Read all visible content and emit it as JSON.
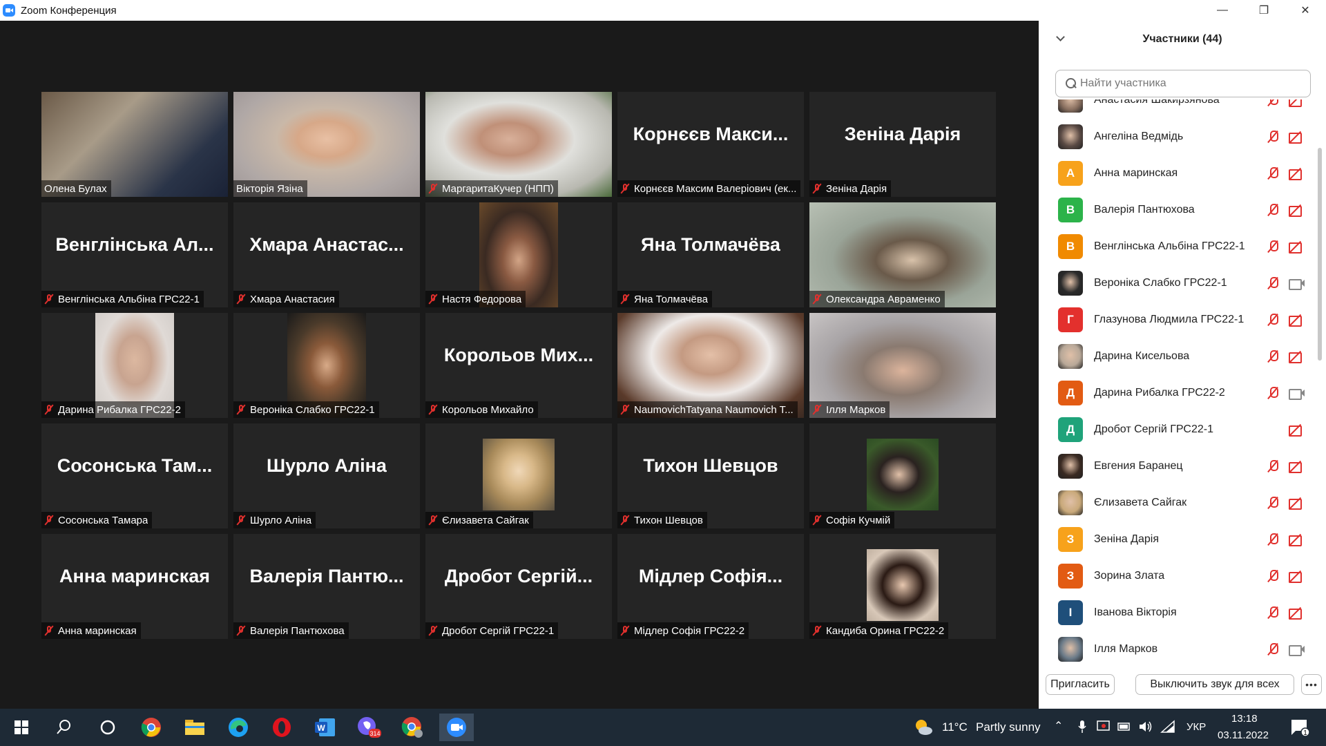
{
  "window": {
    "title": "Zoom Конференция",
    "minimize_glyph": "—",
    "maximize_glyph": "❐",
    "close_glyph": "✕"
  },
  "tiles": [
    {
      "label": "Олена Булах",
      "big_name": "",
      "muted": false,
      "video": true,
      "active": false
    },
    {
      "label": "Вікторія Язіна",
      "big_name": "",
      "muted": false,
      "video": true,
      "active": true
    },
    {
      "label": "МаргаритаКучер  (НПП)",
      "big_name": "",
      "muted": true,
      "video": true,
      "active": false
    },
    {
      "label": "Корнєєв Максим Валерiович (ек...",
      "big_name": "Корнєєв Макси...",
      "muted": true,
      "video": false,
      "active": false
    },
    {
      "label": "Зеніна Дарія",
      "big_name": "Зеніна Дарія",
      "muted": true,
      "video": false,
      "active": false
    },
    {
      "label": "Венглінська Альбіна ГРС22-1",
      "big_name": "Венглінська Ал...",
      "muted": true,
      "video": false,
      "active": false
    },
    {
      "label": "Хмара Анастасия",
      "big_name": "Хмара Анастас...",
      "muted": true,
      "video": false,
      "active": false
    },
    {
      "label": "Настя Федорова",
      "big_name": "",
      "muted": true,
      "video": true,
      "active": false
    },
    {
      "label": "Яна Толмачёва",
      "big_name": "Яна Толмачёва",
      "muted": true,
      "video": false,
      "active": false
    },
    {
      "label": "Олександра Авраменко",
      "big_name": "",
      "muted": true,
      "video": true,
      "active": false
    },
    {
      "label": "Дарина Рибалка ГРС22-2",
      "big_name": "",
      "muted": true,
      "video": true,
      "active": false
    },
    {
      "label": "Вероніка Слабко ГРС22-1",
      "big_name": "",
      "muted": true,
      "video": true,
      "active": false
    },
    {
      "label": "Корольов Михайло",
      "big_name": "Корольов Мих...",
      "muted": true,
      "video": false,
      "active": false
    },
    {
      "label": "NaumovichTatyana Naumovich T...",
      "big_name": "",
      "muted": true,
      "video": true,
      "active": false
    },
    {
      "label": "Ілля Марков",
      "big_name": "",
      "muted": true,
      "video": true,
      "active": false
    },
    {
      "label": "Сосонська Тамара",
      "big_name": "Сосонська Там...",
      "muted": true,
      "video": false,
      "active": false
    },
    {
      "label": "Шурло Аліна",
      "big_name": "Шурло Аліна",
      "muted": true,
      "video": false,
      "active": false
    },
    {
      "label": "Єлизавета Сайгак",
      "big_name": "",
      "muted": true,
      "video": true,
      "active": false
    },
    {
      "label": "Тихон Шевцов",
      "big_name": "Тихон Шевцов",
      "muted": true,
      "video": false,
      "active": false
    },
    {
      "label": "Софія Кучмій",
      "big_name": "",
      "muted": true,
      "video": true,
      "active": false
    },
    {
      "label": "Анна маринская",
      "big_name": "Анна маринская",
      "muted": true,
      "video": false,
      "active": false
    },
    {
      "label": "Валерія Пантюхова",
      "big_name": "Валерія Пантю...",
      "muted": true,
      "video": false,
      "active": false
    },
    {
      "label": "Дробот Сергій ГРС22-1",
      "big_name": "Дробот Сергій...",
      "muted": true,
      "video": false,
      "active": false
    },
    {
      "label": "Мідлер Софія ГРС22-2",
      "big_name": "Мідлер Софія...",
      "muted": true,
      "video": false,
      "active": false
    },
    {
      "label": "Кандиба Орина ГРС22-2",
      "big_name": "",
      "muted": true,
      "video": true,
      "active": false
    }
  ],
  "panel": {
    "title": "Участники (44)",
    "search_placeholder": "Найти участника",
    "participants": [
      {
        "name": "Анастасия Шакирзянова",
        "initial": "",
        "color": "#8a7060",
        "muted": true,
        "cam_off": true
      },
      {
        "name": "Ангеліна Ведмідь",
        "initial": "",
        "color": "#5a4a44",
        "muted": true,
        "cam_off": true
      },
      {
        "name": "Анна маринская",
        "initial": "А",
        "color": "#f7a21b",
        "muted": true,
        "cam_off": true
      },
      {
        "name": "Валерія Пантюхова",
        "initial": "В",
        "color": "#2cb34a",
        "muted": true,
        "cam_off": true
      },
      {
        "name": "Венглінська Альбіна ГРС22-1",
        "initial": "В",
        "color": "#f08a00",
        "muted": true,
        "cam_off": true
      },
      {
        "name": "Вероніка Слабко ГРС22-1",
        "initial": "",
        "color": "#2a2a2a",
        "muted": true,
        "cam_off": false
      },
      {
        "name": "Глазунова Людмила ГРС22-1",
        "initial": "Г",
        "color": "#e3302d",
        "muted": true,
        "cam_off": true
      },
      {
        "name": "Дарина Кисельова",
        "initial": "",
        "color": "#b8a898",
        "muted": true,
        "cam_off": true
      },
      {
        "name": "Дарина Рибалка ГРС22-2",
        "initial": "Д",
        "color": "#e25b13",
        "muted": true,
        "cam_off": false
      },
      {
        "name": "Дробот Сергій ГРС22-1",
        "initial": "Д",
        "color": "#1fa37a",
        "muted": false,
        "cam_off": true
      },
      {
        "name": "Евгения Баранец",
        "initial": "",
        "color": "#3a2a22",
        "muted": true,
        "cam_off": true
      },
      {
        "name": "Єлизавета Сайгак",
        "initial": "",
        "color": "#c9a97a",
        "muted": true,
        "cam_off": true
      },
      {
        "name": "Зеніна Дарія",
        "initial": "З",
        "color": "#f7a21b",
        "muted": true,
        "cam_off": true
      },
      {
        "name": "Зорина Злата",
        "initial": "З",
        "color": "#e25b13",
        "muted": true,
        "cam_off": true
      },
      {
        "name": "Іванова Вікторія",
        "initial": "І",
        "color": "#1f4f7a",
        "muted": true,
        "cam_off": true
      },
      {
        "name": "Ілля Марков",
        "initial": "",
        "color": "#6a7a88",
        "muted": true,
        "cam_off": false
      }
    ],
    "invite_label": "Пригласить",
    "mute_all_label": "Выключить звук для всех",
    "more_label": "•••"
  },
  "taskbar": {
    "weather_temp": "11°C",
    "weather_text": "Partly sunny",
    "language": "УКР",
    "time": "13:18",
    "date": "03.11.2022",
    "viber_badge": "314",
    "notification_count": "1",
    "word_letter": "W"
  }
}
